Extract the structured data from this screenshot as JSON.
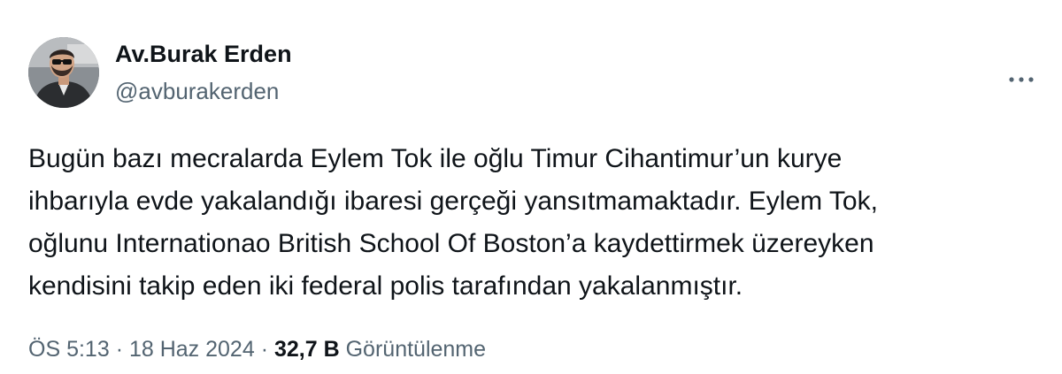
{
  "author": {
    "display_name": "Av.Burak Erden",
    "handle": "@avburakerden",
    "avatar_icon": "user-avatar-photo"
  },
  "tweet": {
    "text": "Bugün bazı mecralarda Eylem Tok ile oğlu Timur Cihantimur’un kurye\nihbarıyla evde yakalandığı ibaresi gerçeği yansıtmamaktadır. Eylem Tok,\noğlunu Internationao British School Of Boston’a kaydettirmek üzereyken\nkendisini takip eden iki federal polis tarafından yakalanmıştır."
  },
  "meta": {
    "time": "ÖS 5:13",
    "separator": "·",
    "date": "18 Haz 2024",
    "views_count": "32,7 B",
    "views_label": "Görüntülenme"
  },
  "icons": {
    "more": "more-horizontal-icon"
  },
  "colors": {
    "text_primary": "#0f1419",
    "text_secondary": "#536471",
    "background": "#ffffff"
  }
}
